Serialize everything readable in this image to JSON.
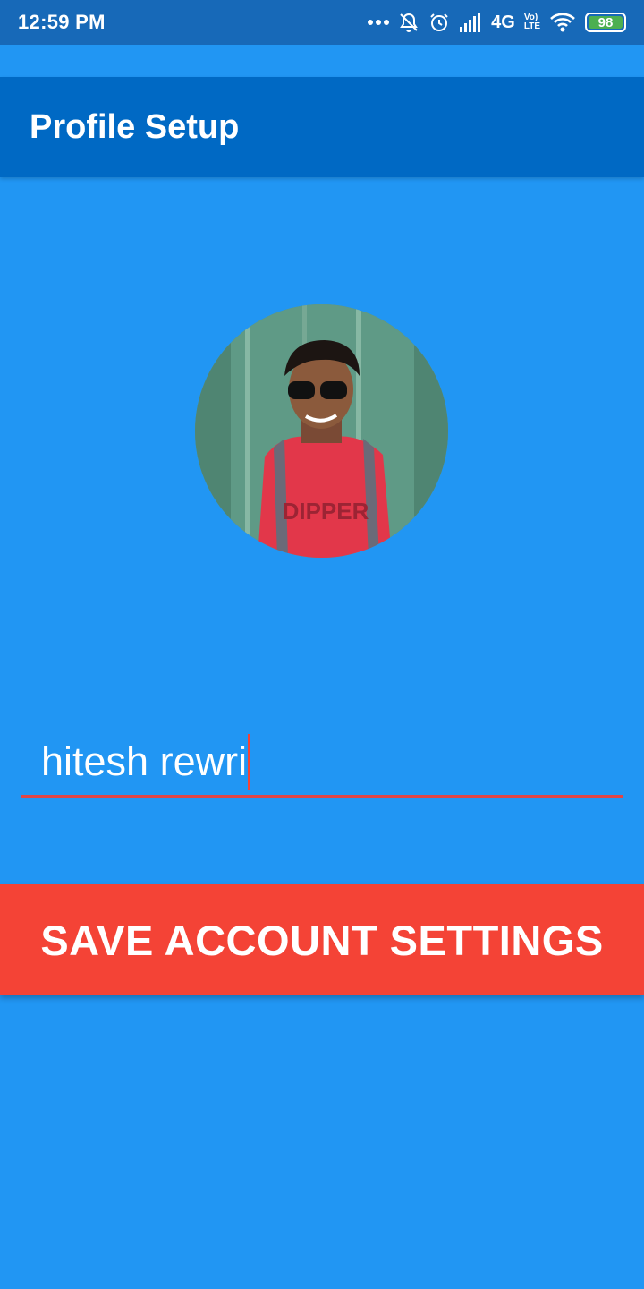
{
  "status_bar": {
    "time": "12:59 PM",
    "network": "4G",
    "volte_top": "Vo)",
    "volte_bottom": "LTE",
    "battery": "98",
    "icons": [
      "more-dots-icon",
      "mute-bell-icon",
      "alarm-icon",
      "signal-icon",
      "wifi-icon",
      "battery-icon"
    ]
  },
  "app_bar": {
    "title": "Profile Setup"
  },
  "profile": {
    "avatar_icon": "profile-photo"
  },
  "form": {
    "name_value": "hitesh rewri"
  },
  "actions": {
    "save_label": "SAVE ACCOUNT SETTINGS"
  },
  "colors": {
    "background": "#2196F3",
    "app_bar": "#0069C4",
    "accent": "#F44336"
  }
}
